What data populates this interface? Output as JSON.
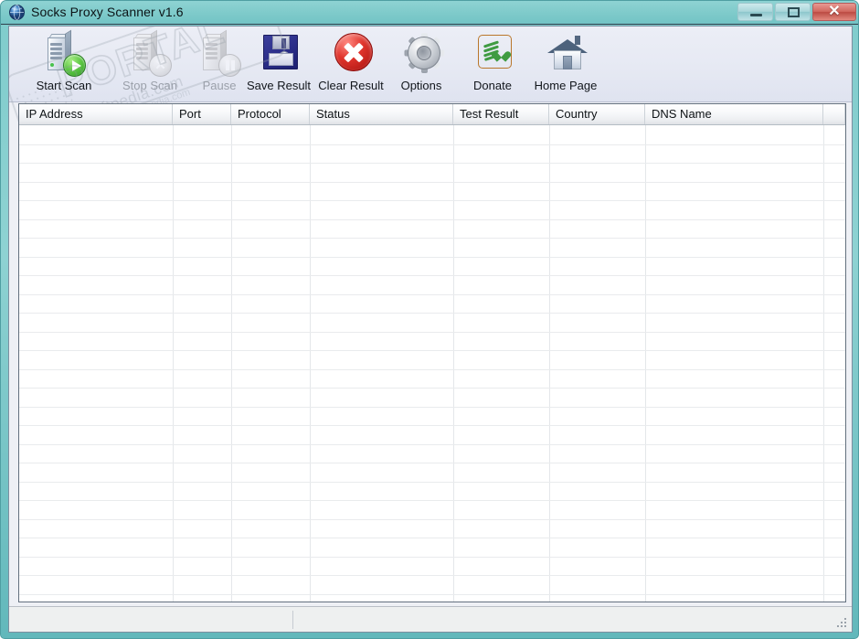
{
  "window": {
    "title": "Socks Proxy Scanner v1.6",
    "icon": "globe-icon",
    "accent_teal": "#7ecaca",
    "controls": {
      "minimize": "–",
      "maximize": "□",
      "close": "✕"
    }
  },
  "toolbar": {
    "buttons": [
      {
        "label": "Start Scan",
        "icon": "server-play-icon",
        "enabled": true
      },
      {
        "label": "Stop Scan",
        "icon": "server-stop-icon",
        "enabled": false
      },
      {
        "label": "Pause",
        "icon": "server-pause-icon",
        "enabled": false
      },
      {
        "label": "Save Result",
        "icon": "floppy-disk-icon",
        "enabled": true
      },
      {
        "label": "Clear Result",
        "icon": "red-x-icon",
        "enabled": true
      },
      {
        "label": "Options",
        "icon": "gear-icon",
        "enabled": true
      },
      {
        "label": "Donate",
        "icon": "donate-hand-icon",
        "enabled": true
      },
      {
        "label": "Home Page",
        "icon": "house-icon",
        "enabled": true
      }
    ]
  },
  "results_table": {
    "columns": [
      {
        "label": "IP Address",
        "width": 168
      },
      {
        "label": "Port",
        "width": 64
      },
      {
        "label": "Protocol",
        "width": 86
      },
      {
        "label": "Status",
        "width": 157
      },
      {
        "label": "Test Result",
        "width": 105
      },
      {
        "label": "Country",
        "width": 105
      },
      {
        "label": "DNS Name",
        "width": 195
      },
      {
        "label": "",
        "width": 24
      }
    ],
    "rows": [],
    "empty": true,
    "visible_row_count": 26
  },
  "statusbar": {
    "left_pane": "",
    "right_pane": "",
    "grip": "resize-grip-icon"
  },
  "watermark": {
    "brand": "PORTAL",
    "tm": "™",
    "url": "www.softpedia.com",
    "small": "softpedia.com"
  }
}
